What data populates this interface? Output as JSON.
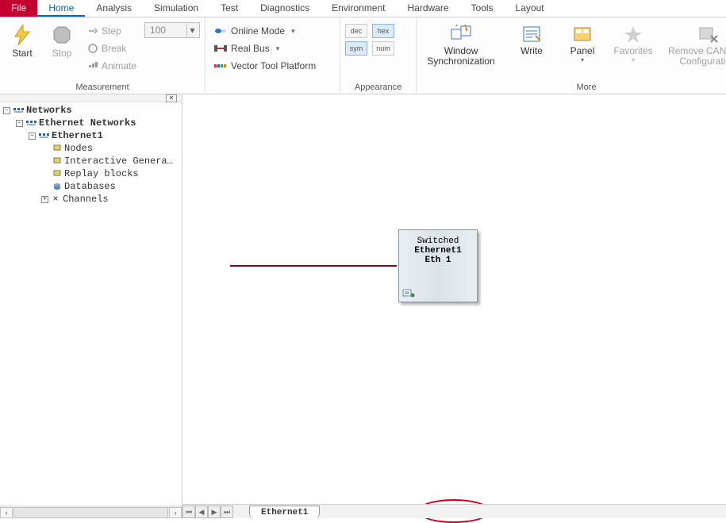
{
  "menu": {
    "file": "File",
    "tabs": [
      "Home",
      "Analysis",
      "Simulation",
      "Test",
      "Diagnostics",
      "Environment",
      "Hardware",
      "Tools",
      "Layout"
    ],
    "active": "Home"
  },
  "ribbon": {
    "start": "Start",
    "stop": "Stop",
    "step": "Step",
    "step_value": "100",
    "break": "Break",
    "animate": "Animate",
    "online_mode": "Online Mode",
    "real_bus": "Real Bus",
    "vector_tool_platform": "Vector Tool Platform",
    "ap_dec": "dec",
    "ap_hex": "hex",
    "ap_sym": "sym",
    "ap_num": "num",
    "window_sync1": "Window",
    "window_sync2": "Synchronization",
    "write": "Write",
    "panel": "Panel",
    "favorites": "Favorites",
    "remove1": "Remove CANopen",
    "remove2": "Configuration",
    "group_measurement": "Measurement",
    "group_appearance": "Appearance",
    "group_more": "More"
  },
  "tree": {
    "root": "Networks",
    "eth_networks": "Ethernet Networks",
    "eth1": "Ethernet1",
    "nodes": "Nodes",
    "igen": "Interactive Genera…",
    "replay": "Replay blocks",
    "db": "Databases",
    "channels": "Channels"
  },
  "device": {
    "line1": "Switched",
    "line2": "Ethernet1",
    "line3": "Eth 1"
  },
  "sheet_tab": "Ethernet1"
}
